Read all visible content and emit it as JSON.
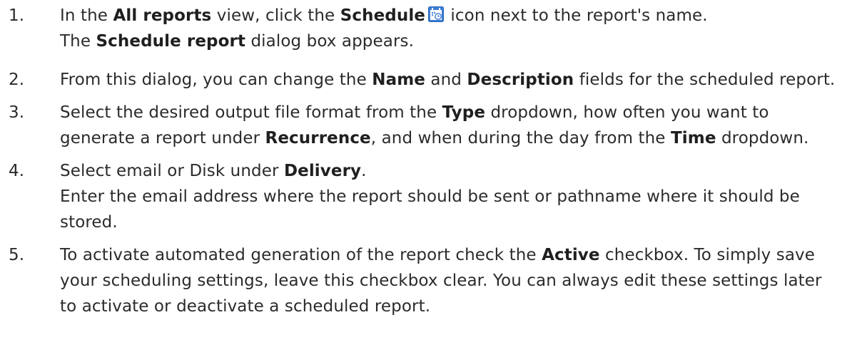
{
  "steps": [
    {
      "number": "1.",
      "line1": {
        "t1": "In the ",
        "b1": "All reports",
        "t2": " view, click the ",
        "b2": "Schedule",
        "t3": " icon next to the report's name."
      },
      "line2": {
        "t1": "The ",
        "b1": "Schedule report",
        "t2": " dialog box appears."
      }
    },
    {
      "number": "2.",
      "t1": "From this dialog, you can change the ",
      "b1": "Name",
      "t2": " and ",
      "b2": "Description",
      "t3": " fields for the scheduled report."
    },
    {
      "number": "3.",
      "t1": "Select the desired output file format from the ",
      "b1": "Type",
      "t2": " dropdown, how often you want to generate a report under ",
      "b2": "Recurrence",
      "t3": ", and when during the day from the ",
      "b3": "Time",
      "t4": " dropdown."
    },
    {
      "number": "4.",
      "t1": "Select email or Disk under ",
      "b1": "Delivery",
      "t2": ".",
      "t3": "Enter the email address where the report should be sent or pathname where it should be stored."
    },
    {
      "number": "5.",
      "t1": "To activate automated generation of the report check the ",
      "b1": "Active",
      "t2": " checkbox. To simply save your scheduling settings, leave this checkbox clear. You can always edit these settings later to activate or deactivate a scheduled report."
    }
  ],
  "icons": {
    "schedule": "calendar-clock-icon"
  },
  "colors": {
    "text": "#2b2b2b",
    "icon_blue": "#3b7dd8"
  }
}
